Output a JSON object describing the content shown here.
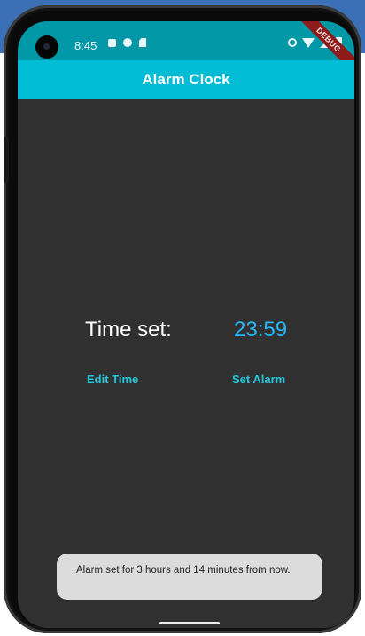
{
  "status_bar": {
    "time": "8:45",
    "left_icons": [
      "notification-icon",
      "settings-app-icon",
      "sd-card-icon"
    ],
    "right_icons": [
      "alarm-icon",
      "wifi-icon",
      "signal-icon",
      "battery-icon"
    ]
  },
  "debug_banner": "DEBUG",
  "app_bar": {
    "title": "Alarm Clock"
  },
  "main": {
    "time_label": "Time set:",
    "time_value": "23:59",
    "edit_button": "Edit Time",
    "set_button": "Set Alarm"
  },
  "snackbar": {
    "message": "Alarm set for 3 hours and 14 minutes from now."
  },
  "colors": {
    "app_bar": "#00bcd4",
    "status_bar": "#0097a7",
    "background": "#303030",
    "accent": "#26c6da",
    "time_value": "#29b6f6",
    "snackbar": "#dcdcdc"
  }
}
